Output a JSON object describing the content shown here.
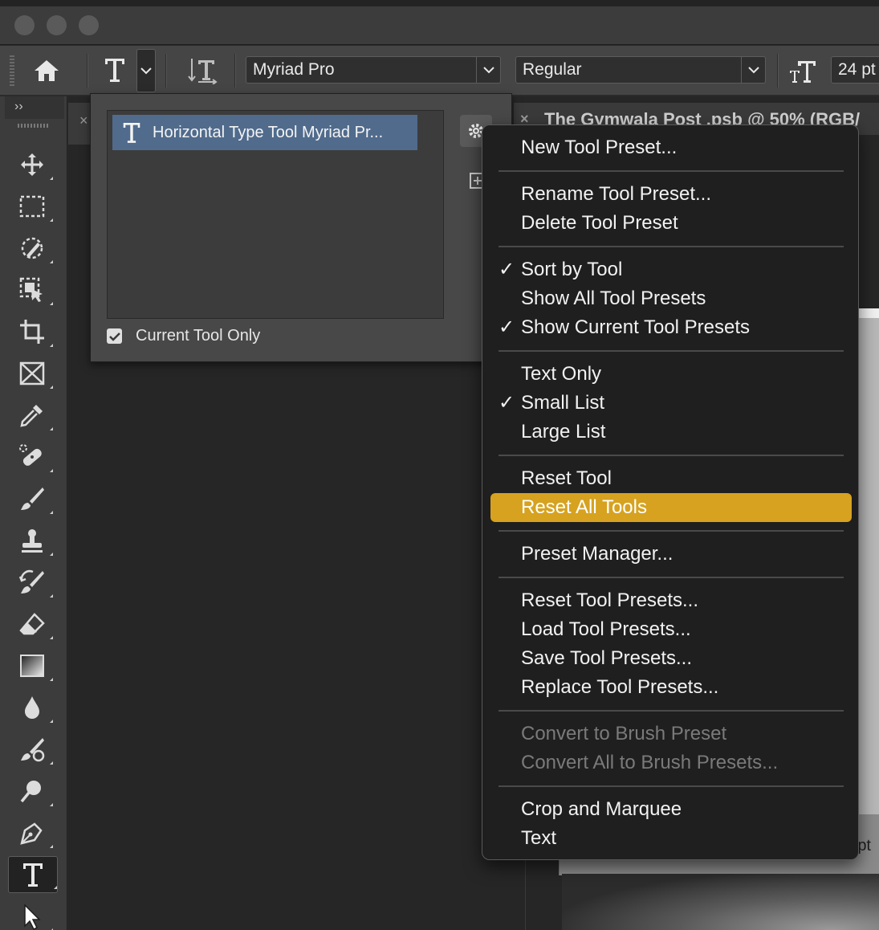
{
  "window": {
    "traffic_lights": [
      "close",
      "minimize",
      "zoom"
    ]
  },
  "options_bar": {
    "home_icon": "home-icon",
    "tool_icon": "type-tool-icon",
    "font_family": "Myriad Pro",
    "font_style": "Regular",
    "font_size": "24 pt"
  },
  "toolbar": {
    "collapse_label": "››",
    "tools": [
      "move-tool",
      "rectangular-marquee-tool",
      "quick-selection-tool",
      "object-selection-tool",
      "crop-tool",
      "frame-tool",
      "eyedropper-tool",
      "spot-healing-brush-tool",
      "brush-tool",
      "clone-stamp-tool",
      "history-brush-tool",
      "eraser-tool",
      "gradient-tool",
      "blur-tool",
      "dodge-tool",
      "path-selection-tool",
      "pen-tool",
      "horizontal-type-tool",
      "direct-selection-tool"
    ],
    "active_tool": "horizontal-type-tool"
  },
  "document": {
    "tab_title": "The Gymwala Post .psb @ 50% (RGB/",
    "partial_unit": "pt"
  },
  "preset_panel": {
    "selected_preset": "Horizontal Type Tool Myriad Pr...",
    "current_tool_only_label": "Current Tool Only",
    "current_tool_only_checked": true
  },
  "menu": {
    "highlight_color": "#d6a21f",
    "groups": [
      [
        {
          "label": "New Tool Preset...",
          "checked": false,
          "enabled": true
        }
      ],
      [
        {
          "label": "Rename Tool Preset...",
          "checked": false,
          "enabled": true
        },
        {
          "label": "Delete Tool Preset",
          "checked": false,
          "enabled": true
        }
      ],
      [
        {
          "label": "Sort by Tool",
          "checked": true,
          "enabled": true
        },
        {
          "label": "Show All Tool Presets",
          "checked": false,
          "enabled": true
        },
        {
          "label": "Show Current Tool Presets",
          "checked": true,
          "enabled": true
        }
      ],
      [
        {
          "label": "Text Only",
          "checked": false,
          "enabled": true
        },
        {
          "label": "Small List",
          "checked": true,
          "enabled": true
        },
        {
          "label": "Large List",
          "checked": false,
          "enabled": true
        }
      ],
      [
        {
          "label": "Reset Tool",
          "checked": false,
          "enabled": true
        },
        {
          "label": "Reset All Tools",
          "checked": false,
          "enabled": true,
          "highlighted": true
        }
      ],
      [
        {
          "label": "Preset Manager...",
          "checked": false,
          "enabled": true
        }
      ],
      [
        {
          "label": "Reset Tool Presets...",
          "checked": false,
          "enabled": true
        },
        {
          "label": "Load Tool Presets...",
          "checked": false,
          "enabled": true
        },
        {
          "label": "Save Tool Presets...",
          "checked": false,
          "enabled": true
        },
        {
          "label": "Replace Tool Presets...",
          "checked": false,
          "enabled": true
        }
      ],
      [
        {
          "label": "Convert to Brush Preset",
          "checked": false,
          "enabled": false
        },
        {
          "label": "Convert All to Brush Presets...",
          "checked": false,
          "enabled": false
        }
      ],
      [
        {
          "label": "Crop and Marquee",
          "checked": false,
          "enabled": true
        },
        {
          "label": "Text",
          "checked": false,
          "enabled": true
        }
      ]
    ],
    "check_glyph": "✓"
  }
}
